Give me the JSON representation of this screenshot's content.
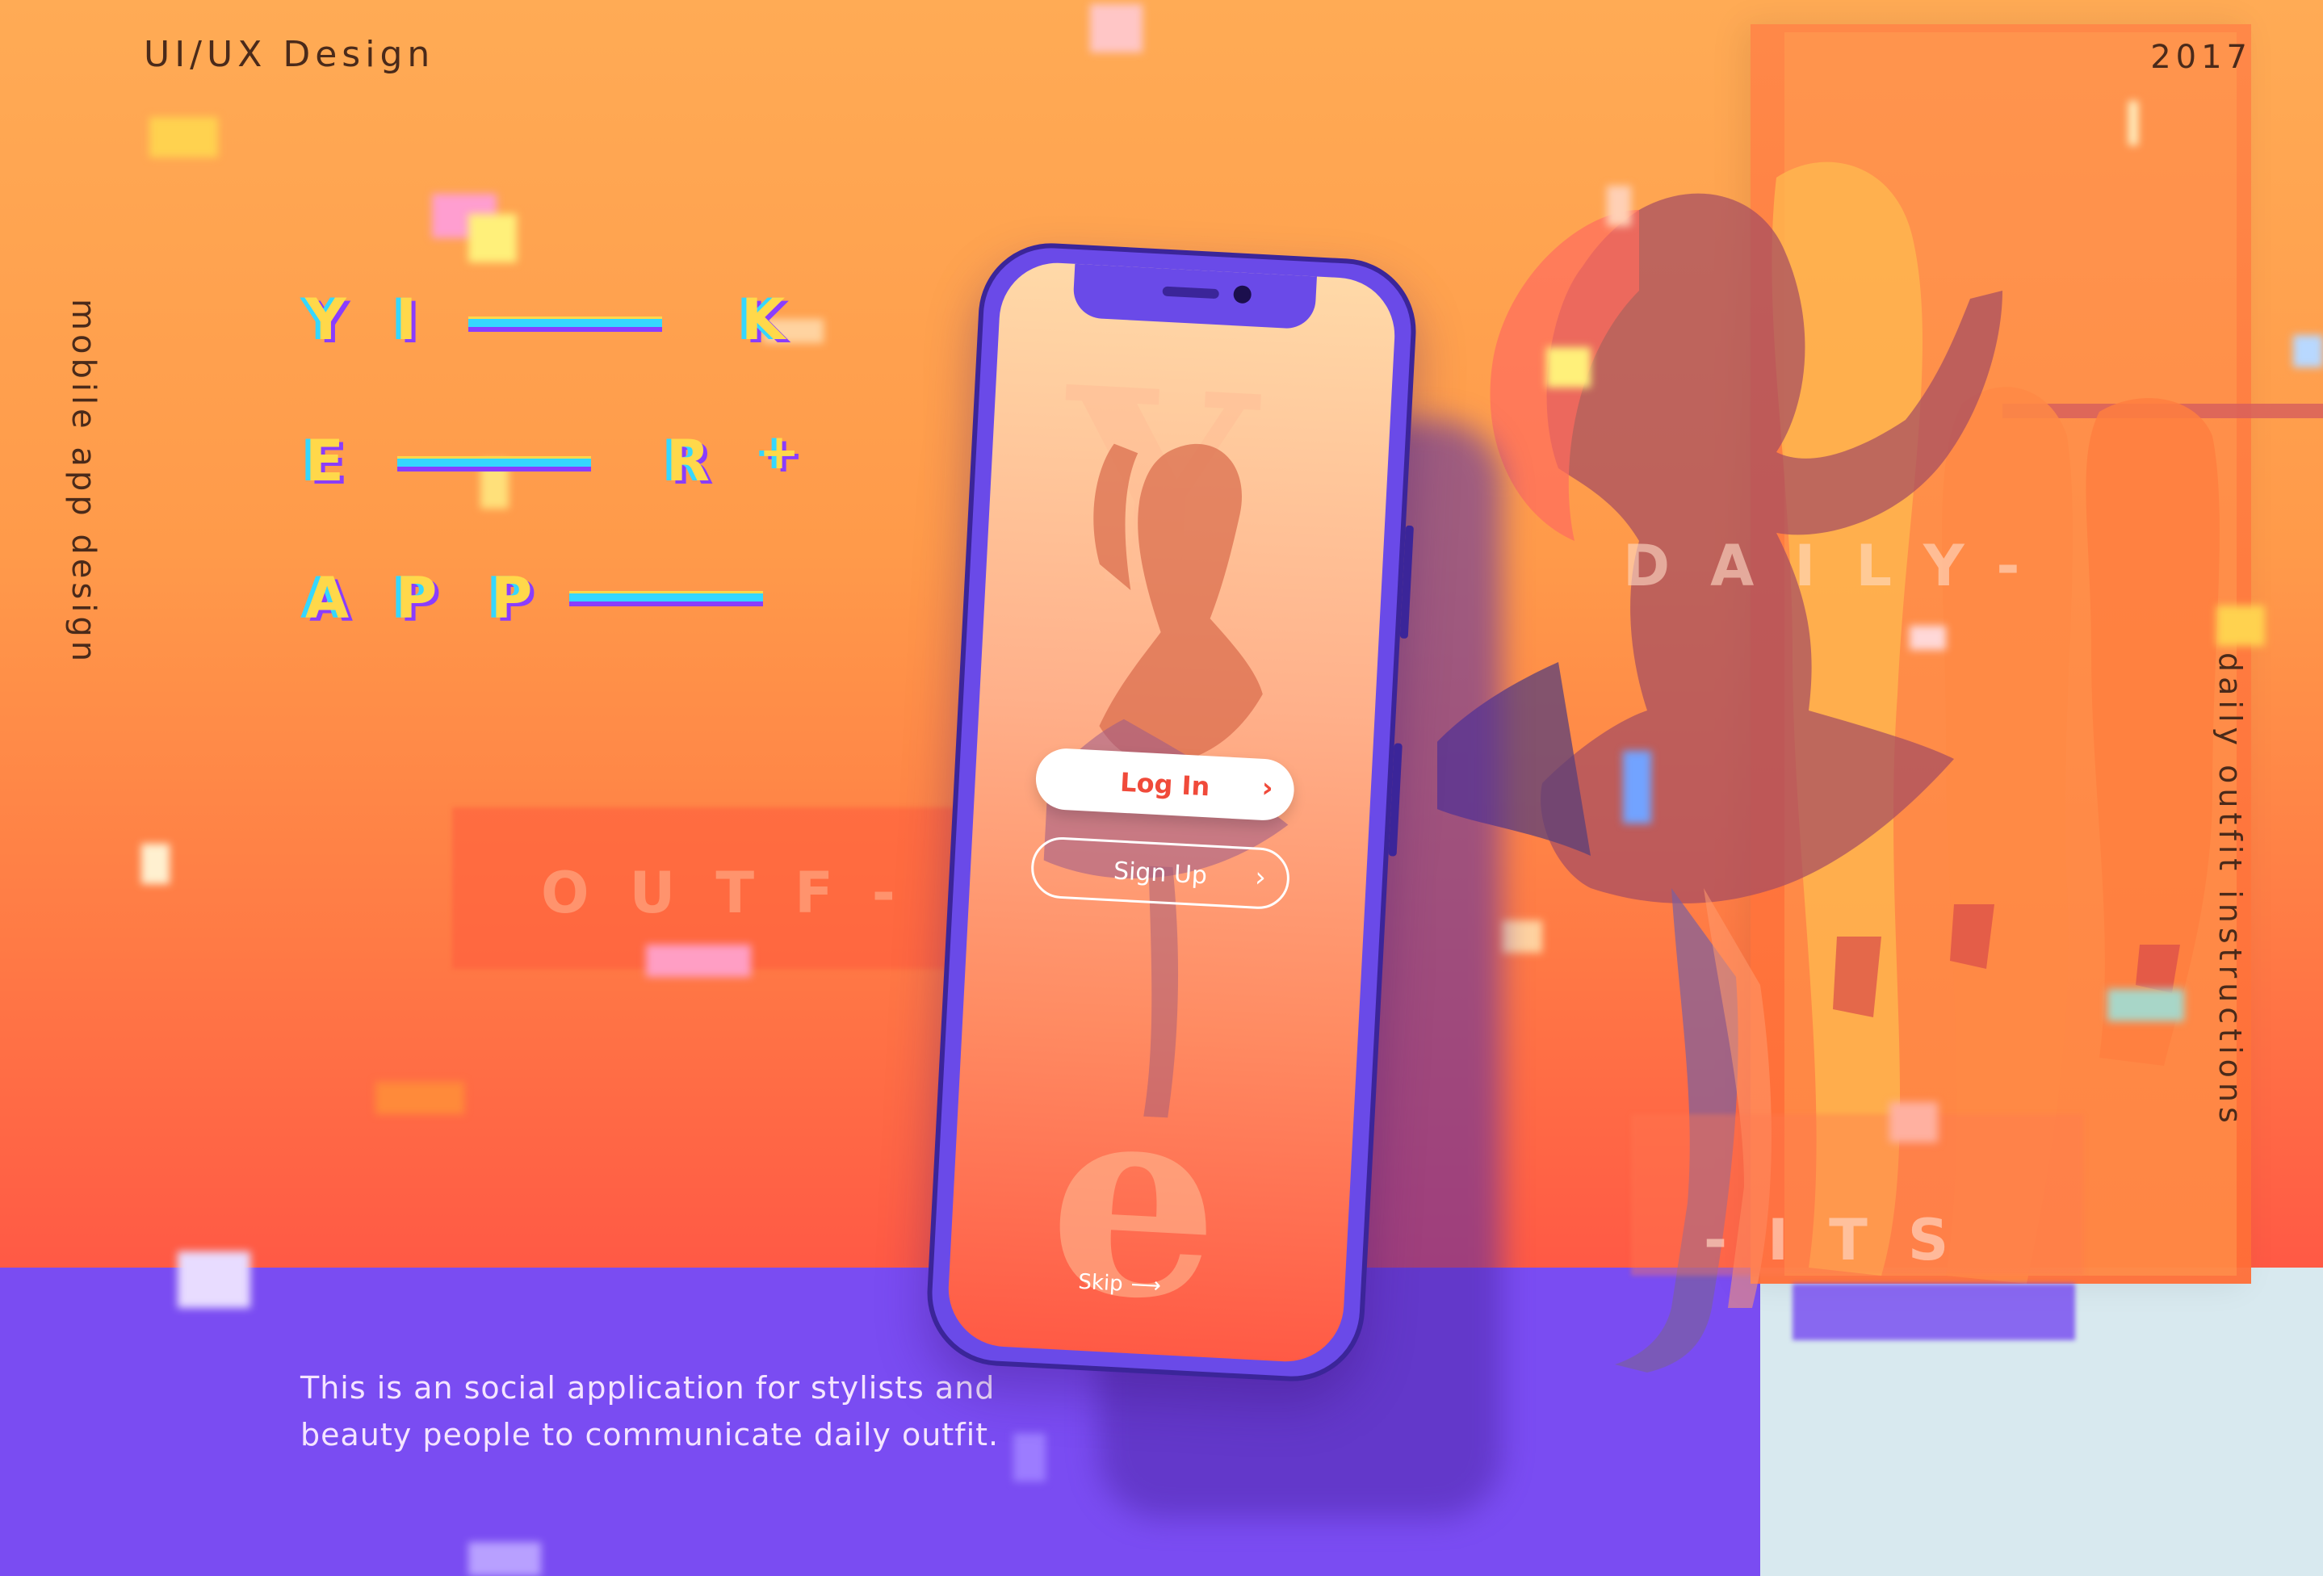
{
  "header": {
    "title": "UI/UX Design",
    "year": "2017"
  },
  "side_labels": {
    "left": "mobile app design",
    "right": "daily outfit instructions"
  },
  "logo": {
    "row1": [
      "Y",
      "I",
      "K"
    ],
    "row2": [
      "E",
      "R",
      "+"
    ],
    "row3": [
      "A",
      "P",
      "P"
    ]
  },
  "background_words": {
    "outf": "OUTF-",
    "daily": "DAILY-",
    "its": "-ITS"
  },
  "description": {
    "line1": "This is an social application for  stylists and",
    "line2": "beauty people to communicate daily outfit."
  },
  "phone": {
    "login_label": "Log In",
    "signup_label": "Sign Up",
    "skip_label": "Skip",
    "chevron_icon": "chevron-right-icon",
    "arrow_icon": "arrow-right-icon"
  },
  "colors": {
    "bg_top": "#ffab55",
    "bg_bottom": "#ff5a45",
    "floor": "#7a4cf2",
    "phone_body": "#6a4ae8",
    "logo_yellow": "#ffd84a",
    "logo_cyan": "#35d7ff",
    "logo_purple": "#8a3dff",
    "login_text": "#f04a3a"
  }
}
